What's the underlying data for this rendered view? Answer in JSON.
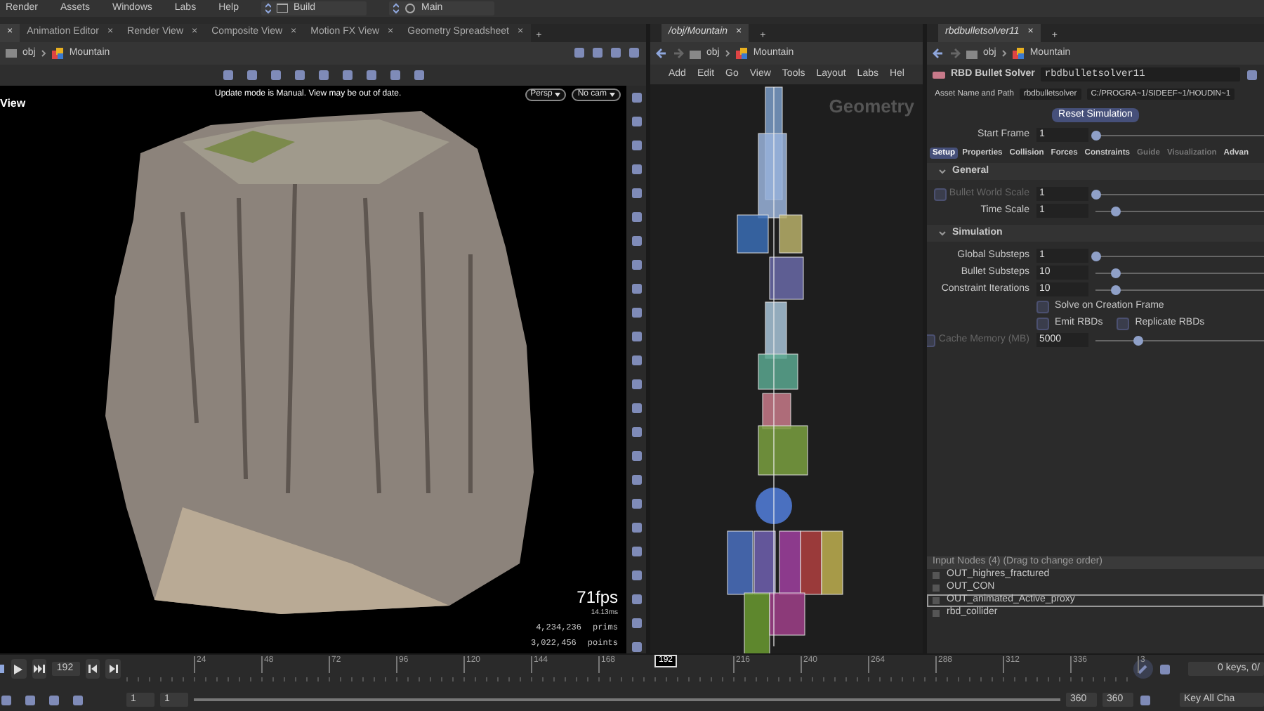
{
  "menubar": {
    "items": [
      "Render",
      "Assets",
      "Windows",
      "Labs",
      "Help"
    ],
    "desktops": [
      {
        "label": "Build"
      },
      {
        "label": "Main"
      }
    ]
  },
  "viewer": {
    "tabs": [
      {
        "close": "×",
        "selected": true
      },
      {
        "label": "Animation Editor",
        "close": "×",
        "selected": false
      },
      {
        "label": "Render View",
        "close": "×",
        "selected": false
      },
      {
        "label": "Composite View",
        "close": "×",
        "selected": false
      },
      {
        "label": "Motion FX View",
        "close": "×",
        "selected": false
      },
      {
        "label": "Geometry Spreadsheet",
        "close": "×",
        "selected": false
      }
    ],
    "add_tab": "+",
    "path": [
      "obj",
      "Mountain"
    ],
    "viewport": {
      "header": "View",
      "notice": "Update mode is Manual. View may be out of date.",
      "camera_menus": [
        "Persp",
        "No cam"
      ],
      "fps": "71fps",
      "frame_time": "14.13ms",
      "stats": [
        {
          "value": "4,234,236",
          "unit": "prims"
        },
        {
          "value": "3,022,456",
          "unit": "points"
        }
      ]
    }
  },
  "network": {
    "tab": "/obj/Mountain",
    "close": "×",
    "add_tab": "+",
    "path": [
      "obj",
      "Mountain"
    ],
    "menu": [
      "Add",
      "Edit",
      "Go",
      "View",
      "Tools",
      "Layout",
      "Labs",
      "Hel"
    ],
    "context_label": "Geometry"
  },
  "parameters": {
    "tab": "rbdbulletsolver11",
    "close": "×",
    "add_tab": "+",
    "path": [
      "obj",
      "Mountain"
    ],
    "node_type": "RBD Bullet Solver",
    "node_name": "rbdbulletsolver11",
    "asset_label": "Asset Name and Path",
    "asset_name": "rbdbulletsolver",
    "asset_path": "C:/PROGRA~1/SIDEEF~1/HOUDIN~1",
    "reset_button": "Reset Simulation",
    "start_frame": {
      "label": "Start Frame",
      "value": "1",
      "level": 0
    },
    "tabs": [
      {
        "label": "Setup",
        "selected": true,
        "disabled": false
      },
      {
        "label": "Properties",
        "selected": false,
        "disabled": false
      },
      {
        "label": "Collision",
        "selected": false,
        "disabled": false
      },
      {
        "label": "Forces",
        "selected": false,
        "disabled": false
      },
      {
        "label": "Constraints",
        "selected": false,
        "disabled": false
      },
      {
        "label": "Guide",
        "selected": false,
        "disabled": true
      },
      {
        "label": "Visualization",
        "selected": false,
        "disabled": true
      },
      {
        "label": "Advan",
        "selected": false,
        "disabled": false
      }
    ],
    "sections": [
      {
        "title": "General",
        "expanded": true,
        "params": [
          {
            "kind": "slider",
            "label": "Bullet World Scale",
            "value": "1",
            "level": 0,
            "disabled": true,
            "toggle": {
              "checked": false
            }
          },
          {
            "kind": "slider",
            "label": "Time Scale",
            "value": "1",
            "level": 0.12,
            "disabled": false
          }
        ]
      },
      {
        "title": "Simulation",
        "expanded": true,
        "params": [
          {
            "kind": "slider",
            "label": "Global Substeps",
            "value": "1",
            "level": 0,
            "disabled": false
          },
          {
            "kind": "slider",
            "label": "Bullet Substeps",
            "value": "10",
            "level": 0.12,
            "disabled": false
          },
          {
            "kind": "slider",
            "label": "Constraint Iterations",
            "value": "10",
            "level": 0.12,
            "disabled": false
          },
          {
            "kind": "checks",
            "items": [
              {
                "label": "Solve on Creation Frame",
                "checked": false
              }
            ]
          },
          {
            "kind": "checks",
            "items": [
              {
                "label": "Emit RBDs",
                "checked": false
              },
              {
                "label": "Replicate RBDs",
                "checked": false
              }
            ]
          },
          {
            "kind": "slider",
            "label": "Cache Memory (MB)",
            "value": "5000",
            "level": 0.25,
            "disabled": true,
            "toggle": {
              "checked": false
            }
          }
        ]
      }
    ],
    "input_nodes": {
      "header": "Input Nodes (4) (Drag to change order)",
      "items": [
        {
          "label": "OUT_highres_fractured",
          "selected": false
        },
        {
          "label": "OUT_CON",
          "selected": false
        },
        {
          "label": "OUT_animated_Active_proxy",
          "selected": true
        },
        {
          "label": "rbd_collider",
          "selected": false
        }
      ]
    }
  },
  "timeline": {
    "current_frame": "192",
    "marker": "192",
    "ticks": [
      "24",
      "48",
      "72",
      "96",
      "120",
      "144",
      "168",
      "216",
      "240",
      "264",
      "288",
      "312",
      "336",
      "3"
    ],
    "range_start": [
      "1",
      "1"
    ],
    "range_bar": {
      "level": 1
    },
    "range_end": [
      "360",
      "360"
    ],
    "keys": "0 keys, 0/",
    "key_mode": "Key All Cha"
  }
}
